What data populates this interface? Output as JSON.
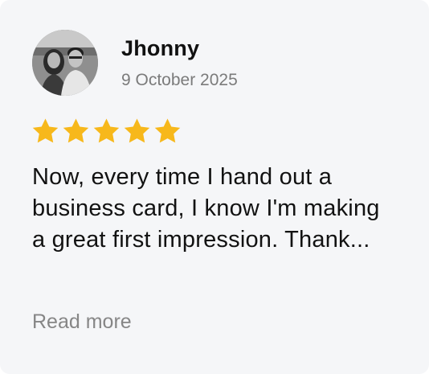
{
  "review": {
    "author_name": "Jhonny",
    "date": "9 October 2025",
    "rating": 5,
    "rating_max": 5,
    "text": "Now, every time I hand out a business card, I know I'm making a great first impression. Thank...",
    "read_more_label": "Read more"
  },
  "colors": {
    "card_background": "#f5f6f8",
    "star": "#f7b81b",
    "name": "#111111",
    "date": "#7b7b7b",
    "read_more": "#868686"
  },
  "icons": {
    "avatar": "avatar-photo",
    "star": "star-icon"
  }
}
